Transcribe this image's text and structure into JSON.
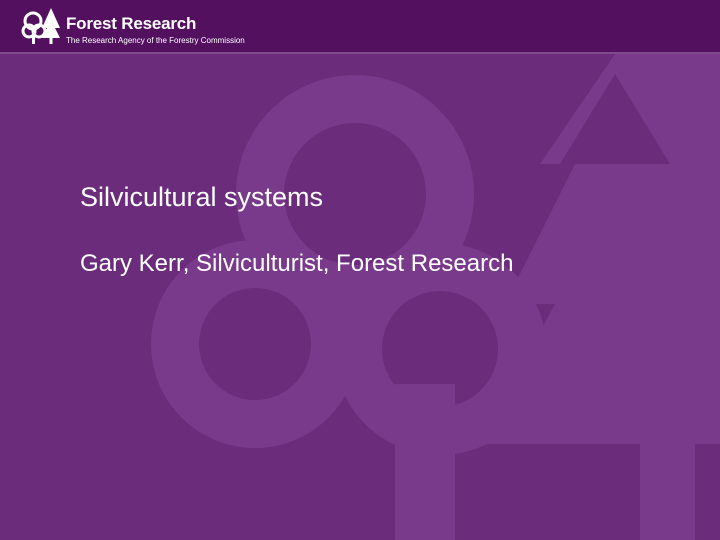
{
  "brand": {
    "name": "Forest Research",
    "tagline": "The Research Agency of the Forestry Commission",
    "logo_icon": "tree-logo-icon"
  },
  "slide": {
    "title": "Silvicultural systems",
    "subtitle": "Gary Kerr, Silviculturist, Forest Research"
  },
  "colors": {
    "background": "#6b2c7c",
    "header": "#53105f",
    "watermark": "#7a3a8c",
    "text": "#ffffff"
  }
}
